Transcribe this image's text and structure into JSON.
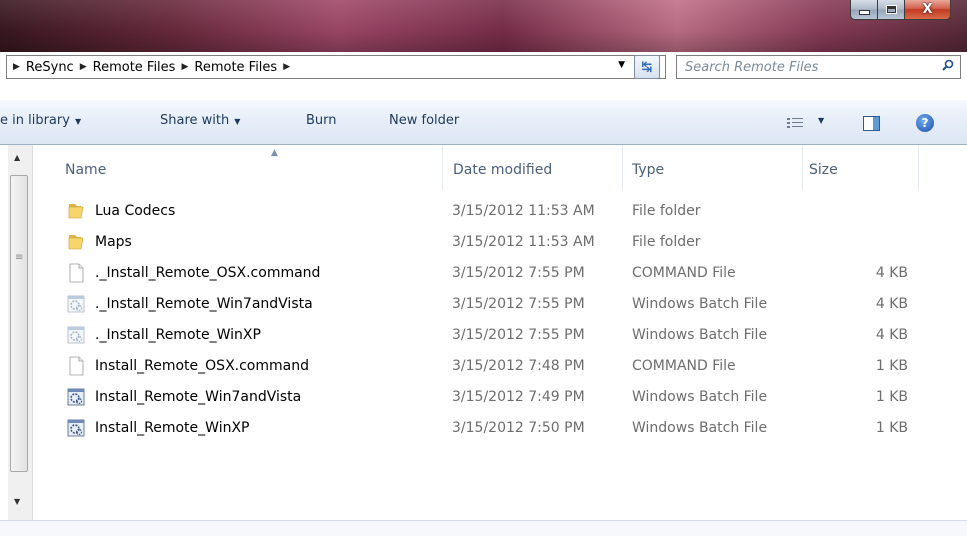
{
  "window": {
    "minimize_icon": "minimize-icon",
    "maximize_icon": "maximize-icon",
    "close_icon": "close-icon",
    "close_glyph": "X"
  },
  "address": {
    "crumbs": [
      "ReSync",
      "Remote Files",
      "Remote Files"
    ],
    "search_placeholder": "Search Remote Files"
  },
  "toolbar": {
    "library_label": "e in library",
    "share_label": "Share with",
    "burn_label": "Burn",
    "new_folder_label": "New folder"
  },
  "columns": {
    "name": "Name",
    "date": "Date modified",
    "type": "Type",
    "size": "Size"
  },
  "files": [
    {
      "name": "Lua Codecs",
      "date": "3/15/2012 11:53 AM",
      "type": "File folder",
      "size": "",
      "icon": "folder-icon"
    },
    {
      "name": "Maps",
      "date": "3/15/2012 11:53 AM",
      "type": "File folder",
      "size": "",
      "icon": "folder-icon"
    },
    {
      "name": "._Install_Remote_OSX.command",
      "date": "3/15/2012 7:55 PM",
      "type": "COMMAND File",
      "size": "4 KB",
      "icon": "blank-file-icon"
    },
    {
      "name": "._Install_Remote_Win7andVista",
      "date": "3/15/2012 7:55 PM",
      "type": "Windows Batch File",
      "size": "4 KB",
      "icon": "batch-file-icon-faded"
    },
    {
      "name": "._Install_Remote_WinXP",
      "date": "3/15/2012 7:55 PM",
      "type": "Windows Batch File",
      "size": "4 KB",
      "icon": "batch-file-icon-faded"
    },
    {
      "name": "Install_Remote_OSX.command",
      "date": "3/15/2012 7:48 PM",
      "type": "COMMAND File",
      "size": "1 KB",
      "icon": "blank-file-icon"
    },
    {
      "name": "Install_Remote_Win7andVista",
      "date": "3/15/2012 7:49 PM",
      "type": "Windows Batch File",
      "size": "1 KB",
      "icon": "batch-file-icon"
    },
    {
      "name": "Install_Remote_WinXP",
      "date": "3/15/2012 7:50 PM",
      "type": "Windows Batch File",
      "size": "1 KB",
      "icon": "batch-file-icon"
    }
  ]
}
